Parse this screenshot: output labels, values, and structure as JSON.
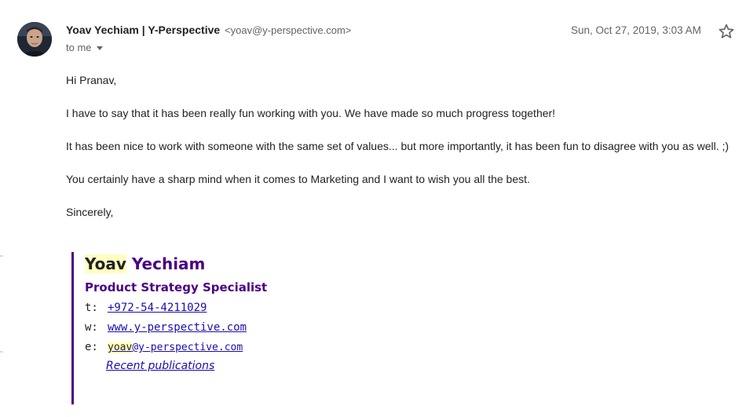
{
  "header": {
    "sender_name": "Yoav Yechiam | Y-Perspective",
    "sender_email": "<yoav@y-perspective.com>",
    "recipient": "to me",
    "date": "Sun, Oct 27, 2019, 3:03 AM"
  },
  "body": {
    "greeting": "Hi Pranav,",
    "paragraphs": [
      "I have to say that it has been really fun working with you. We have made so much progress together!",
      "It has been nice to work with someone with the same set of values... but more importantly, it has been fun to disagree with you as well. ;)",
      "You certainly have a sharp mind when it comes to Marketing and I want to wish you all the best."
    ],
    "closing": "Sincerely,"
  },
  "signature": {
    "first_name": "Yoav",
    "last_name": "Yechiam",
    "title": "Product Strategy Specialist",
    "phone_label": "t:",
    "phone": "+972-54-4211029",
    "web_label": "w:",
    "web": "www.y-perspective.com",
    "email_label": "e:",
    "email_user": "yoav",
    "email_domain": "@y-perspective.com",
    "publications_link": "Recent publications"
  },
  "colors": {
    "signature_accent": "#4b0082",
    "highlight": "#ffffbf",
    "link": "#1a0dab",
    "meta_text": "#5f6368"
  },
  "icons": {
    "star": "star-outline-icon",
    "expand_recipients": "caret-down-icon"
  }
}
